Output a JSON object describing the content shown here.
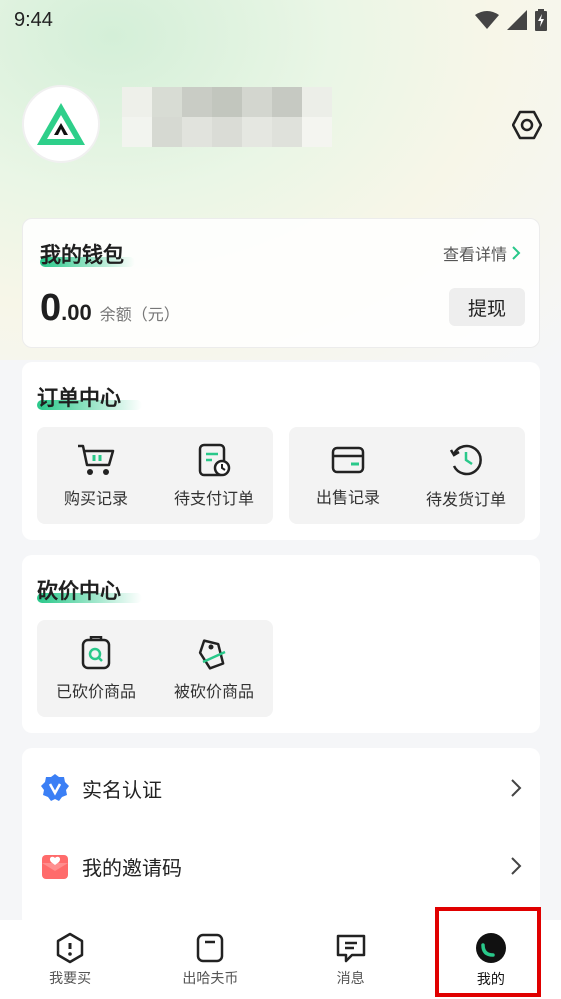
{
  "status": {
    "time": "9:44"
  },
  "wallet": {
    "title": "我的钱包",
    "detail_link": "查看详情",
    "amount_int": "0",
    "amount_dec": ".00",
    "amount_label": "余额（元）",
    "withdraw_label": "提现"
  },
  "orders": {
    "title": "订单中心",
    "items": [
      {
        "label": "购买记录",
        "icon": "cart-icon"
      },
      {
        "label": "待支付订单",
        "icon": "pending-payment-icon"
      },
      {
        "label": "出售记录",
        "icon": "wallet-icon"
      },
      {
        "label": "待发货订单",
        "icon": "history-clock-icon"
      }
    ]
  },
  "bargain": {
    "title": "砍价中心",
    "items": [
      {
        "label": "已砍价商品",
        "icon": "bag-search-icon"
      },
      {
        "label": "被砍价商品",
        "icon": "price-tag-icon"
      }
    ]
  },
  "list": [
    {
      "label": "实名认证",
      "icon": "verified-badge-icon"
    },
    {
      "label": "我的邀请码",
      "icon": "invite-envelope-icon"
    }
  ],
  "nav": [
    {
      "label": "我要买",
      "icon": "buy-icon"
    },
    {
      "label": "出哈夫币",
      "icon": "sell-icon"
    },
    {
      "label": "消息",
      "icon": "message-icon"
    },
    {
      "label": "我的",
      "icon": "profile-icon"
    }
  ],
  "colors": {
    "accent": "#29c88a",
    "highlight": "#e00000"
  }
}
